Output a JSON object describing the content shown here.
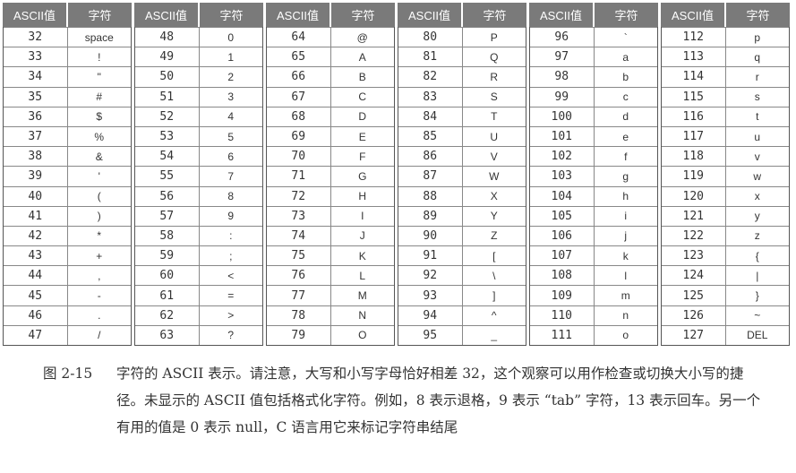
{
  "table": {
    "headers": [
      "ASCII值",
      "字符"
    ],
    "groups": [
      [
        [
          "32",
          "space"
        ],
        [
          "33",
          "!"
        ],
        [
          "34",
          "\""
        ],
        [
          "35",
          "#"
        ],
        [
          "36",
          "$"
        ],
        [
          "37",
          "%"
        ],
        [
          "38",
          "&"
        ],
        [
          "39",
          "'"
        ],
        [
          "40",
          "("
        ],
        [
          "41",
          ")"
        ],
        [
          "42",
          "*"
        ],
        [
          "43",
          "+"
        ],
        [
          "44",
          ","
        ],
        [
          "45",
          "-"
        ],
        [
          "46",
          "."
        ],
        [
          "47",
          "/"
        ]
      ],
      [
        [
          "48",
          "0"
        ],
        [
          "49",
          "1"
        ],
        [
          "50",
          "2"
        ],
        [
          "51",
          "3"
        ],
        [
          "52",
          "4"
        ],
        [
          "53",
          "5"
        ],
        [
          "54",
          "6"
        ],
        [
          "55",
          "7"
        ],
        [
          "56",
          "8"
        ],
        [
          "57",
          "9"
        ],
        [
          "58",
          ":"
        ],
        [
          "59",
          ";"
        ],
        [
          "60",
          "<"
        ],
        [
          "61",
          "="
        ],
        [
          "62",
          ">"
        ],
        [
          "63",
          "?"
        ]
      ],
      [
        [
          "64",
          "@"
        ],
        [
          "65",
          "A"
        ],
        [
          "66",
          "B"
        ],
        [
          "67",
          "C"
        ],
        [
          "68",
          "D"
        ],
        [
          "69",
          "E"
        ],
        [
          "70",
          "F"
        ],
        [
          "71",
          "G"
        ],
        [
          "72",
          "H"
        ],
        [
          "73",
          "I"
        ],
        [
          "74",
          "J"
        ],
        [
          "75",
          "K"
        ],
        [
          "76",
          "L"
        ],
        [
          "77",
          "M"
        ],
        [
          "78",
          "N"
        ],
        [
          "79",
          "O"
        ]
      ],
      [
        [
          "80",
          "P"
        ],
        [
          "81",
          "Q"
        ],
        [
          "82",
          "R"
        ],
        [
          "83",
          "S"
        ],
        [
          "84",
          "T"
        ],
        [
          "85",
          "U"
        ],
        [
          "86",
          "V"
        ],
        [
          "87",
          "W"
        ],
        [
          "88",
          "X"
        ],
        [
          "89",
          "Y"
        ],
        [
          "90",
          "Z"
        ],
        [
          "91",
          "["
        ],
        [
          "92",
          "\\"
        ],
        [
          "93",
          "]"
        ],
        [
          "94",
          "^"
        ],
        [
          "95",
          "_"
        ]
      ],
      [
        [
          "96",
          "`"
        ],
        [
          "97",
          "a"
        ],
        [
          "98",
          "b"
        ],
        [
          "99",
          "c"
        ],
        [
          "100",
          "d"
        ],
        [
          "101",
          "e"
        ],
        [
          "102",
          "f"
        ],
        [
          "103",
          "g"
        ],
        [
          "104",
          "h"
        ],
        [
          "105",
          "i"
        ],
        [
          "106",
          "j"
        ],
        [
          "107",
          "k"
        ],
        [
          "108",
          "l"
        ],
        [
          "109",
          "m"
        ],
        [
          "110",
          "n"
        ],
        [
          "111",
          "o"
        ]
      ],
      [
        [
          "112",
          "p"
        ],
        [
          "113",
          "q"
        ],
        [
          "114",
          "r"
        ],
        [
          "115",
          "s"
        ],
        [
          "116",
          "t"
        ],
        [
          "117",
          "u"
        ],
        [
          "118",
          "v"
        ],
        [
          "119",
          "w"
        ],
        [
          "120",
          "x"
        ],
        [
          "121",
          "y"
        ],
        [
          "122",
          "z"
        ],
        [
          "123",
          "{"
        ],
        [
          "124",
          "|"
        ],
        [
          "125",
          "}"
        ],
        [
          "126",
          "~"
        ],
        [
          "127",
          "DEL"
        ]
      ]
    ]
  },
  "caption": {
    "label": "图 2-15",
    "text": "字符的 ASCII 表示。请注意，大写和小写字母恰好相差 32，这个观察可以用作检查或切换大小写的捷径。未显示的 ASCII 值包括格式化字符。例如，8 表示退格，9 表示 “tab” 字符，13 表示回车。另一个有用的值是 0 表示 null，C 语言用它来标记字符串结尾"
  }
}
